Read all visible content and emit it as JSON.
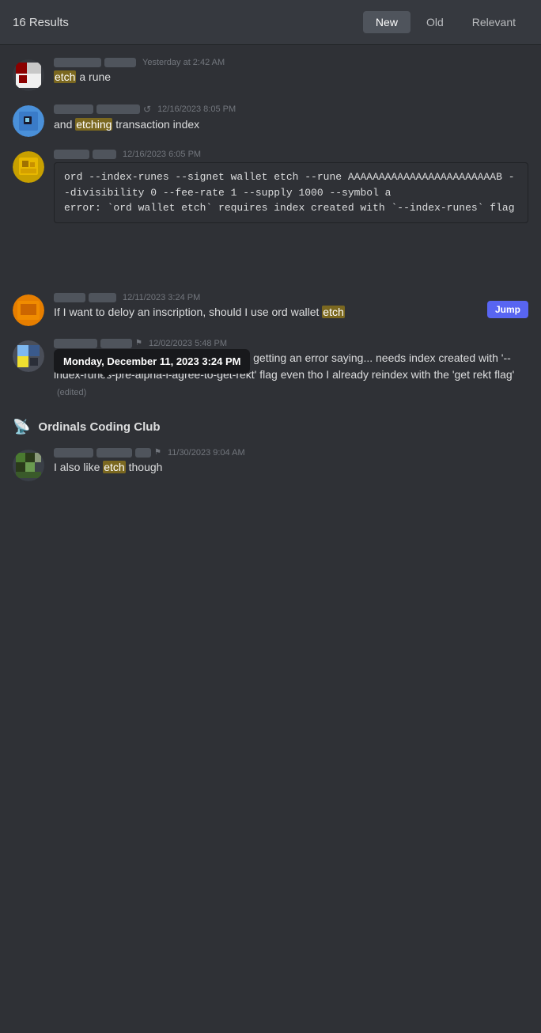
{
  "header": {
    "results_count": "16 Results",
    "tabs": [
      {
        "id": "new",
        "label": "New",
        "active": true
      },
      {
        "id": "old",
        "label": "Old",
        "active": false
      },
      {
        "id": "relevant",
        "label": "Relevant",
        "active": false
      }
    ]
  },
  "messages": [
    {
      "id": "msg1",
      "avatar_type": "red_white",
      "timestamp": "Yesterday at 2:42 AM",
      "text_parts": [
        {
          "type": "highlight",
          "text": "etch"
        },
        {
          "type": "text",
          "text": " a rune"
        }
      ]
    },
    {
      "id": "msg2",
      "avatar_type": "blue_face",
      "timestamp": "12/16/2023 8:05 PM",
      "text_parts": [
        {
          "type": "text",
          "text": "and "
        },
        {
          "type": "highlight",
          "text": "etching"
        },
        {
          "type": "text",
          "text": " transaction index"
        }
      ]
    },
    {
      "id": "msg3",
      "avatar_type": "gold",
      "timestamp": "12/16/2023 6:05 PM",
      "code": "ord --index-runes --signet wallet etch --rune AAAAAAAAAAAAAAAAAAAAAAAAB --divisibility 0 --fee-rate 1 --supply 1000 --symbol a\nerror: `ord wallet etch` requires index created with `--index-runes` flag",
      "tooltip": "Monday, December 11, 2023 3:24 PM"
    },
    {
      "id": "msg4",
      "avatar_type": "orange_square",
      "timestamp": "12/11/2023 3:24 PM",
      "has_jump": true,
      "jump_label": "Jump",
      "text_parts": [
        {
          "type": "text",
          "text": "If I want to deloy an inscription, should I use ord wallet "
        },
        {
          "type": "highlight",
          "text": "etch"
        }
      ]
    },
    {
      "id": "msg5",
      "avatar_type": "multi_color",
      "timestamp": "12/02/2023 5:48 PM",
      "text_parts": [
        {
          "type": "text",
          "text": "I'm trying to "
        },
        {
          "type": "highlight",
          "text": "etch"
        },
        {
          "type": "text",
          "text": " some Runes and keep getting an error saying... needs index created with '--index-runes-pre-alpha-l-agree-to-get-rekt' flag even tho I already reindex with the 'get rekt flag'"
        },
        {
          "type": "edited",
          "text": " (edited)"
        }
      ]
    }
  ],
  "section": {
    "icon": "📡",
    "label": "Ordinals Coding Club"
  },
  "section_messages": [
    {
      "id": "smsg1",
      "avatar_type": "green_pixel",
      "timestamp": "11/30/2023 9:04 AM",
      "text_parts": [
        {
          "type": "text",
          "text": "I also like "
        },
        {
          "type": "highlight",
          "text": "etch"
        },
        {
          "type": "text",
          "text": " though"
        }
      ]
    }
  ]
}
